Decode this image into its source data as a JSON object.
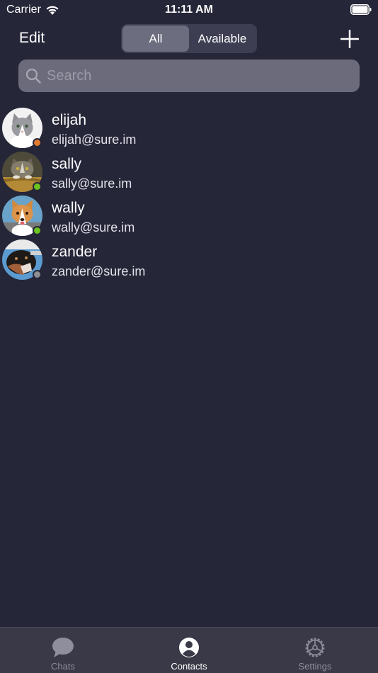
{
  "status_bar": {
    "carrier": "Carrier",
    "time": "11:11 AM",
    "icons": [
      "wifi-icon",
      "battery-icon"
    ]
  },
  "nav": {
    "edit_label": "Edit",
    "segments": [
      {
        "label": "All",
        "selected": true
      },
      {
        "label": "Available",
        "selected": false
      }
    ],
    "add_icon": "plus-icon"
  },
  "search": {
    "placeholder": "Search",
    "value": ""
  },
  "contacts": [
    {
      "name": "elijah",
      "email": "elijah@sure.im",
      "status": "away",
      "status_color": "#e07a2e",
      "avatar": "gray-white-cat-photo"
    },
    {
      "name": "sally",
      "email": "sally@sure.im",
      "status": "available",
      "status_color": "#6cc51f",
      "avatar": "tabby-cat-in-basket-photo"
    },
    {
      "name": "wally",
      "email": "wally@sure.im",
      "status": "available",
      "status_color": "#6cc51f",
      "avatar": "corgi-dog-photo"
    },
    {
      "name": "zander",
      "email": "zander@sure.im",
      "status": "offline",
      "status_color": "#8e8e93",
      "avatar": "rottweiler-dog-photo"
    }
  ],
  "tab_bar": {
    "tabs": [
      {
        "label": "Chats",
        "icon": "chat-bubble-icon",
        "active": false
      },
      {
        "label": "Contacts",
        "icon": "person-circle-icon",
        "active": true
      },
      {
        "label": "Settings",
        "icon": "gear-icon",
        "active": false
      }
    ]
  },
  "colors": {
    "background": "#262639",
    "search_field": "#6b6b7b",
    "segment_active": "#6d6d80",
    "tab_bar": "#393948",
    "available": "#6cc51f",
    "away": "#e07a2e",
    "offline": "#8e8e93"
  }
}
